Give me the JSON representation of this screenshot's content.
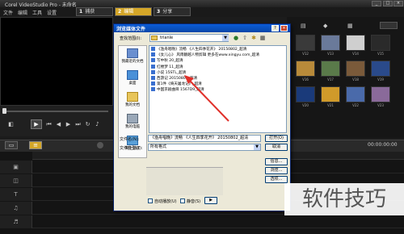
{
  "app": {
    "title": "Corel VideoStudio Pro - 未命名",
    "menu": [
      "文件",
      "编辑",
      "工具",
      "设置"
    ],
    "steps": [
      {
        "num": "1",
        "label": "捕获"
      },
      {
        "num": "2",
        "label": "编辑"
      },
      {
        "num": "3",
        "label": "分享"
      }
    ],
    "timecode": "00:00:00:00",
    "library_captions": [
      "V12",
      "V13",
      "V14",
      "V15",
      "V16",
      "V17",
      "V18",
      "V19",
      "V20",
      "V21",
      "V22",
      "V23"
    ]
  },
  "dialog": {
    "title": "浏览媒体文件",
    "help": "?",
    "close": "×",
    "look_in_label": "查找范围(I):",
    "look_in_value": "trianle",
    "places": [
      "我最近的文档",
      "桌面",
      "我的文档",
      "我的电脑",
      "网上邻居"
    ],
    "files": [
      "《渔舟唱晚》流畅 《人生四季花开》 20150802_超清",
      "《女儿心》 风雨翻越人物剪辑 更多在www.xingyu.com_超清",
      "写中秋 20_超清",
      "红楼梦 11_超清",
      "小说 15STL_超清",
      "西游记 20150801_超清",
      "第1件《倚天屠龙记》_超清",
      "中国京剧曲目 1567D9_超清"
    ],
    "file_name_label": "文件名(N):",
    "file_name_value": "《渔舟唱晚》流畅 《人生四季花开》 20150802_超清",
    "file_type_label": "文件类型(T):",
    "file_type_value": "所有格式",
    "open_button": "打开(O)",
    "cancel_button": "取消",
    "info_button": "信息...",
    "browse_button": "浏览...",
    "options_button": "选项...",
    "autoplay_label": "自动播放(U)",
    "mute_label": "静音(S)",
    "play_glyph": "▶"
  },
  "watermark": "软件技巧",
  "colors": {
    "annotation_arrow": "#e0302a",
    "dialog_title": "#0a5cd8"
  }
}
